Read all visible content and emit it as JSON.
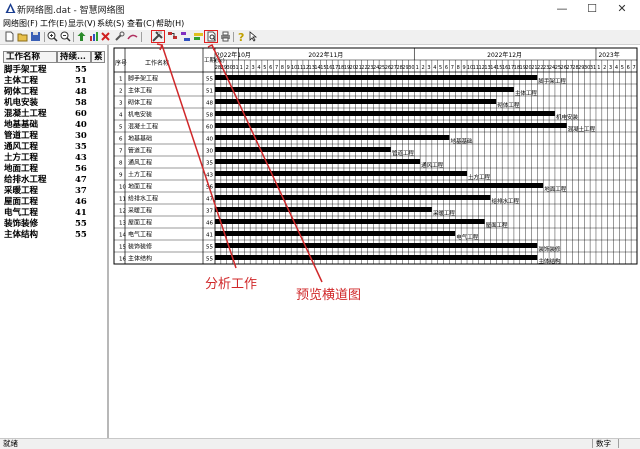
{
  "window": {
    "title": "新网络图.dat - 智慧网络图",
    "minimize_glyph": "—",
    "maximize_glyph": "☐",
    "close_glyph": "✕"
  },
  "menu": [
    "网络图(F)",
    "工作(E)",
    "显示(V)",
    "系统(S)",
    "查看(C)",
    "帮助(H)"
  ],
  "toolbar": {
    "icons": [
      "new-file-icon",
      "open-folder-icon",
      "save-icon",
      "zoom-in-icon",
      "zoom-out-icon",
      "add-task-icon",
      "chart-icon",
      "delete-icon",
      "tool-icon",
      "link-icon",
      "analyze-work-icon",
      "arrange-icon",
      "network-icon",
      "flag-icon",
      "preview-icon",
      "print-icon",
      "help-icon",
      "pointer-icon"
    ],
    "highlighted": [
      "analyze-work-icon",
      "preview-icon"
    ]
  },
  "task_list": {
    "headers": [
      "工作名称",
      "持续...",
      "紧"
    ],
    "rows": [
      {
        "name": "脚手架工程",
        "duration": 55
      },
      {
        "name": "主体工程",
        "duration": 51
      },
      {
        "name": "砌体工程",
        "duration": 48
      },
      {
        "name": "机电安装",
        "duration": 58
      },
      {
        "name": "混凝土工程",
        "duration": 60
      },
      {
        "name": "地基基础",
        "duration": 40
      },
      {
        "name": "管道工程",
        "duration": 30
      },
      {
        "name": "通风工程",
        "duration": 35
      },
      {
        "name": "土方工程",
        "duration": 43
      },
      {
        "name": "地面工程",
        "duration": 56
      },
      {
        "name": "给排水工程",
        "duration": 47
      },
      {
        "name": "采暖工程",
        "duration": 37
      },
      {
        "name": "屋面工程",
        "duration": 46
      },
      {
        "name": "电气工程",
        "duration": 41
      },
      {
        "name": "装饰装修",
        "duration": 55
      },
      {
        "name": "主体结构",
        "duration": 55
      }
    ]
  },
  "gantt": {
    "col_headers": {
      "index": "序号",
      "name": "工作名称",
      "duration": "工期(天)"
    },
    "months": [
      "2022年10月",
      "2022年11月",
      "2022年12月",
      "2023年"
    ],
    "days": [
      28,
      29,
      30,
      31,
      1,
      2,
      3,
      4,
      5,
      6,
      7,
      8,
      9,
      10,
      11,
      12,
      13,
      14,
      15,
      16,
      17,
      18,
      19,
      20,
      21,
      22,
      23,
      24,
      25,
      26,
      27,
      28,
      29,
      30,
      1,
      2,
      3,
      4,
      5,
      6,
      7,
      8,
      9,
      10,
      11,
      12,
      13,
      14,
      15,
      16,
      17,
      18,
      19,
      20,
      21,
      22,
      23,
      24,
      25,
      26,
      27,
      28,
      29,
      30,
      31,
      1,
      2,
      3,
      4,
      5,
      6,
      7
    ],
    "tasks": [
      {
        "no": 1,
        "name": "脚手架工程",
        "duration": 55,
        "start_day": 0,
        "label": "脚手架工程"
      },
      {
        "no": 2,
        "name": "主体工程",
        "duration": 51,
        "start_day": 0,
        "label": "主体工程"
      },
      {
        "no": 3,
        "name": "砌体工程",
        "duration": 48,
        "start_day": 0,
        "label": "砌体工程"
      },
      {
        "no": 4,
        "name": "机电安装",
        "duration": 58,
        "start_day": 0,
        "label": "机电安装"
      },
      {
        "no": 5,
        "name": "混凝土工程",
        "duration": 60,
        "start_day": 0,
        "label": "混凝土工程"
      },
      {
        "no": 6,
        "name": "地基基础",
        "duration": 40,
        "start_day": 0,
        "label": "地基基础"
      },
      {
        "no": 7,
        "name": "管道工程",
        "duration": 30,
        "start_day": 0,
        "label": "管道工程"
      },
      {
        "no": 8,
        "name": "通风工程",
        "duration": 35,
        "start_day": 0,
        "label": "通风工程"
      },
      {
        "no": 9,
        "name": "土方工程",
        "duration": 43,
        "start_day": 0,
        "label": "土方工程"
      },
      {
        "no": 10,
        "name": "地面工程",
        "duration": 56,
        "start_day": 0,
        "label": "地面工程"
      },
      {
        "no": 11,
        "name": "给排水工程",
        "duration": 47,
        "start_day": 0,
        "label": "给排水工程"
      },
      {
        "no": 12,
        "name": "采暖工程",
        "duration": 37,
        "start_day": 0,
        "label": "采暖工程"
      },
      {
        "no": 13,
        "name": "屋面工程",
        "duration": 46,
        "start_day": 0,
        "label": "屋面工程"
      },
      {
        "no": 14,
        "name": "电气工程",
        "duration": 41,
        "start_day": 0,
        "label": "电气工程"
      },
      {
        "no": 15,
        "name": "装饰装修",
        "duration": 55,
        "start_day": 0,
        "label": "装饰装修"
      },
      {
        "no": 16,
        "name": "主体结构",
        "duration": 55,
        "start_day": 0,
        "label": "主体结构"
      }
    ]
  },
  "annotations": {
    "analyze": "分析工作",
    "preview": "预览横道图",
    "color": "#d0282a"
  },
  "status": {
    "text": "就绪",
    "num": "数字"
  }
}
